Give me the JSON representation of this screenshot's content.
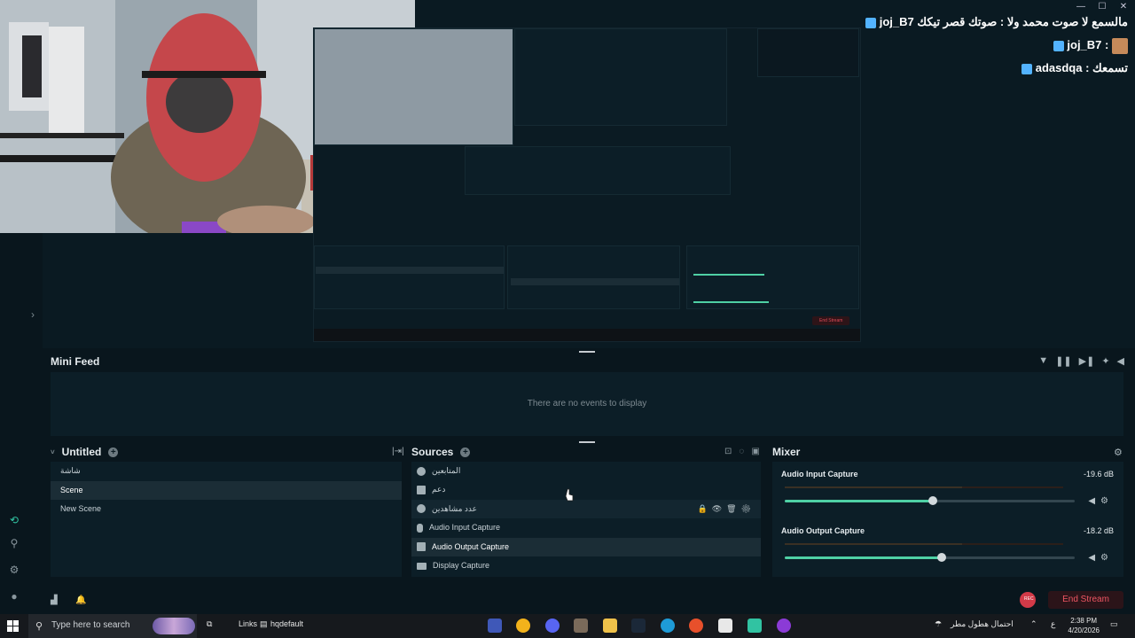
{
  "window": {
    "controls": [
      "—",
      "☐",
      "✕"
    ]
  },
  "chat": {
    "messages": [
      {
        "user": "joj_B7",
        "text": "مالسمع لا صوت محمد ولا : صوتك قصر تيكك"
      },
      {
        "user": "joj_B7",
        "text": ":"
      },
      {
        "user": "adasdqa",
        "text": "تسمعك :"
      }
    ]
  },
  "mini_feed": {
    "title": "Mini Feed",
    "empty_text": "There are no events to display"
  },
  "scenes": {
    "title": "Untitled",
    "items": [
      {
        "label": "شاشة"
      },
      {
        "label": "Scene"
      },
      {
        "label": "New Scene"
      }
    ]
  },
  "sources": {
    "title": "Sources",
    "items": [
      {
        "label": "المتابعين"
      },
      {
        "label": "دعم"
      },
      {
        "label": "عدد مشاهدين"
      },
      {
        "label": "Audio Input Capture"
      },
      {
        "label": "Audio Output Capture"
      },
      {
        "label": "Display Capture"
      }
    ]
  },
  "mixer": {
    "title": "Mixer",
    "channels": [
      {
        "name": "Audio Input Capture",
        "db": "-19.6 dB",
        "volume": 0.51
      },
      {
        "name": "Audio Output Capture",
        "db": "-18.2 dB",
        "volume": 0.54
      }
    ]
  },
  "status_bar": {
    "end_stream": "End Stream",
    "rec_label": "REC"
  },
  "taskbar": {
    "search_placeholder": "Type here to search",
    "links_label": "Links",
    "file_label": "hqdefault",
    "weather": "احتمال هطول مطر",
    "lang": "ع",
    "time": "2:38 PM",
    "date": "4/20/2026"
  },
  "colors": {
    "accent": "#4fd1a5",
    "danger": "#ef5663",
    "panel": "#0c1e27",
    "background": "#09161d"
  }
}
